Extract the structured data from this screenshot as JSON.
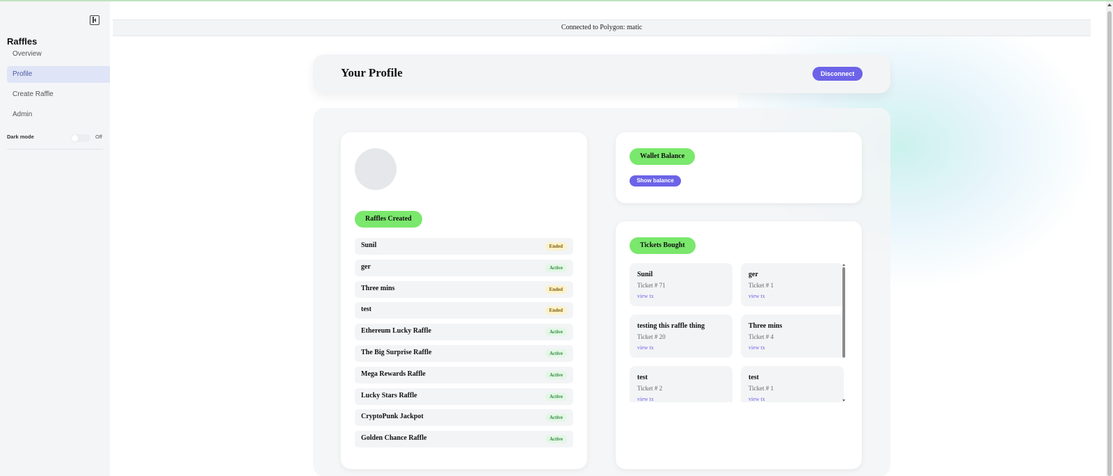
{
  "sidebar": {
    "title": "Raffles",
    "items": [
      {
        "label": "Overview"
      },
      {
        "label": "Profile"
      },
      {
        "label": "Create Raffle"
      },
      {
        "label": "Admin"
      }
    ],
    "dark_mode_label": "Dark mode",
    "dark_mode_state": "Off"
  },
  "banner": {
    "text": "Connected to Polygon: matic"
  },
  "header": {
    "title": "Your Profile",
    "disconnect_label": "Disconnect"
  },
  "raffles_created": {
    "heading": "Raffles Created",
    "items": [
      {
        "name": "Sunil",
        "status": "Ended"
      },
      {
        "name": "ger",
        "status": "Active"
      },
      {
        "name": "Three mins",
        "status": "Ended"
      },
      {
        "name": "test",
        "status": "Ended"
      },
      {
        "name": "Ethereum Lucky Raffle",
        "status": "Active"
      },
      {
        "name": "The Big Surprise Raffle",
        "status": "Active"
      },
      {
        "name": "Mega Rewards Raffle",
        "status": "Active"
      },
      {
        "name": "Lucky Stars Raffle",
        "status": "Active"
      },
      {
        "name": "CryptoPunk Jackpot",
        "status": "Active"
      },
      {
        "name": "Golden Chance Raffle",
        "status": "Active"
      }
    ]
  },
  "wallet": {
    "heading": "Wallet Balance",
    "show_balance_label": "Show balance"
  },
  "tickets": {
    "heading": "Tickets Bought",
    "link_label": "view tx",
    "items": [
      {
        "name": "Sunil",
        "ticket": "Ticket # 71"
      },
      {
        "name": "ger",
        "ticket": "Ticket # 1"
      },
      {
        "name": "testing this raffle thing",
        "ticket": "Ticket # 20"
      },
      {
        "name": "Three mins",
        "ticket": "Ticket # 4"
      },
      {
        "name": "test",
        "ticket": "Ticket # 2"
      },
      {
        "name": "test",
        "ticket": "Ticket # 1"
      }
    ]
  },
  "colors": {
    "accent": "#6c63e8",
    "green_pill": "#7ae86c",
    "ended_badge": "#fdf2c9",
    "active_badge": "#e4f7e6"
  }
}
